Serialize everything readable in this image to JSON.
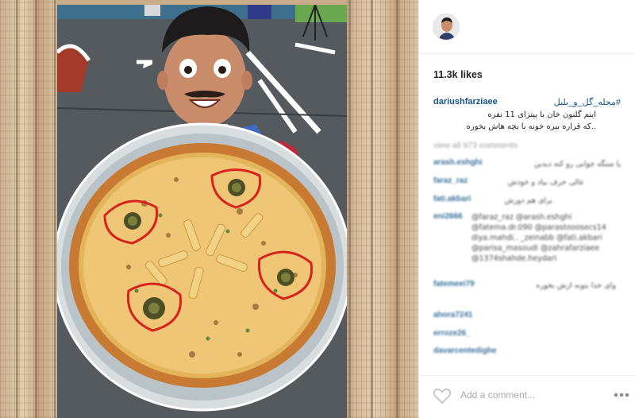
{
  "post": {
    "likes": "11.3k likes",
    "username": "dariushfarziaee",
    "hashtag": "#محله_گل_و_بلبل",
    "caption_lines": [
      "اینم گلنون خان با پیتزای 11 نفره",
      "..که قراره ببره خونه با بچه هاش بخوره"
    ],
    "view_all": "view all 973 comments"
  },
  "comments": [
    {
      "user": "arash.eshghi",
      "text": "پا سنگه جوابی رو کنه دیدین"
    },
    {
      "user": "faraz_raz",
      "text": "عالی حرف بیاد و خودش"
    },
    {
      "user": "fati.akbari",
      "text": "برای هم دورش"
    },
    {
      "user": "eni2666",
      "text": "@faraz_raz @arash.eshghi @fatema.dr.090 @parastooosecs14 diya.mahdi.. _zeinabb @fati.akbari @parisa_masoudi @zahrafarziaee @1374shahde.heydari"
    },
    {
      "user": "fatemeei79",
      "text": "وای خدا بتونه ازش بخوره"
    },
    {
      "user": "ahora7241",
      "text": ""
    },
    {
      "user": "erroze26_",
      "text": ""
    },
    {
      "user": "davarcentedighe",
      "text": ""
    }
  ],
  "footer": {
    "comment_placeholder": "Add a comment...",
    "heart_icon": "heart-outline-icon",
    "more_icon": "ellipsis-icon"
  },
  "colors": {
    "link": "#125688",
    "text": "#262626",
    "muted": "#8e8e8e"
  }
}
